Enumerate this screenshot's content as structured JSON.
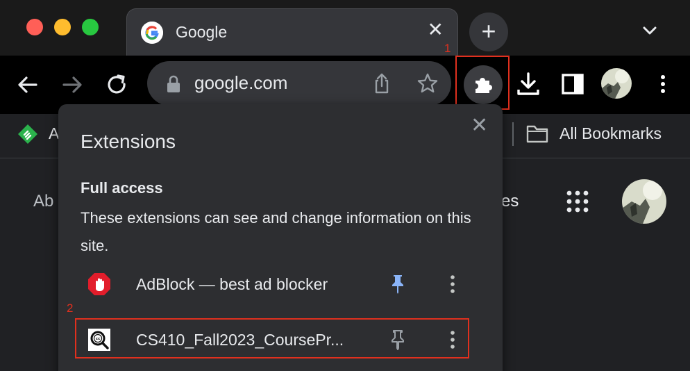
{
  "window": {
    "tab_title": "Google",
    "tab_close_glyph": "✕",
    "new_tab_glyph": "+"
  },
  "toolbar": {
    "url": "google.com"
  },
  "annotations": {
    "marker_1": "1",
    "marker_2": "2",
    "color": "#e0301e"
  },
  "bookmarks": {
    "partial_label": "A",
    "folder_label": "All Bookmarks"
  },
  "page": {
    "left_text": "Ab",
    "right_text": "es"
  },
  "extensions_popup": {
    "title": "Extensions",
    "close_glyph": "✕",
    "section_title": "Full access",
    "section_desc": "These extensions can see and change information on this site.",
    "items": [
      {
        "name": "AdBlock — best ad blocker",
        "icon": "adblock-icon",
        "pinned": true
      },
      {
        "name": "CS410_Fall2023_CoursePr...",
        "icon": "cc-search-icon",
        "pinned": false
      }
    ]
  },
  "colors": {
    "pinned_blue": "#8ab4f8",
    "unpinned_gray": "#9aa0a6",
    "adblock_red": "#e21d2b"
  }
}
